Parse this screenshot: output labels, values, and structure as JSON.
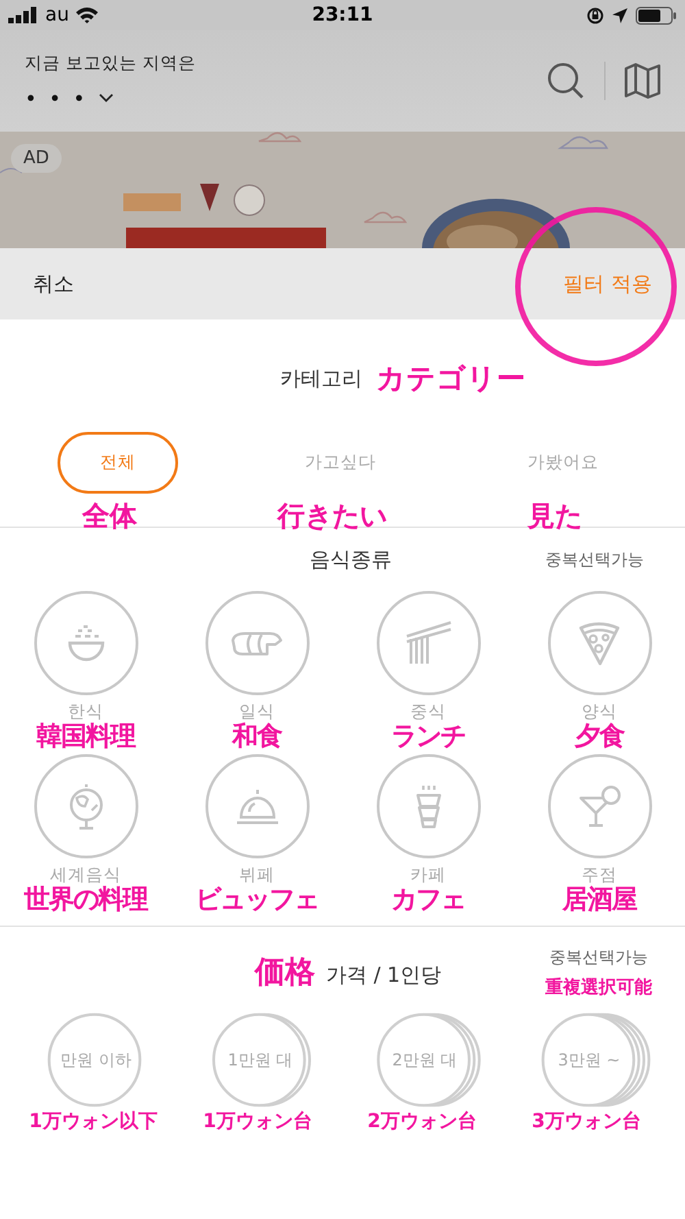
{
  "status_bar": {
    "carrier": "au",
    "time": "23:11"
  },
  "header": {
    "region_label": "지금 보고있는 지역은",
    "region_value": "• • •"
  },
  "ad": {
    "badge": "AD"
  },
  "sheet_bar": {
    "cancel": "취소",
    "apply": "필터 적용",
    "apply_circled": true
  },
  "category": {
    "title": "카테고리",
    "annotation": "カテゴリー",
    "tabs": [
      {
        "label": "전체",
        "annotation": "全体",
        "selected": true
      },
      {
        "label": "가고싶다",
        "annotation": "行きたい",
        "selected": false
      },
      {
        "label": "가봤어요",
        "annotation": "見た",
        "selected": false
      }
    ]
  },
  "food": {
    "title": "음식종류",
    "note": "중복선택가능",
    "items": [
      {
        "label": "한식",
        "annotation": "韓国料理",
        "selected": false
      },
      {
        "label": "일식",
        "annotation": "和食",
        "selected": false
      },
      {
        "label": "중식",
        "annotation": "ランチ",
        "selected": false
      },
      {
        "label": "양식",
        "annotation": "夕食",
        "selected": false
      },
      {
        "label": "세계음식",
        "annotation": "世界の料理",
        "selected": false
      },
      {
        "label": "뷔페",
        "annotation": "ビュッフェ",
        "selected": false
      },
      {
        "label": "카페",
        "annotation": "カフェ",
        "selected": false
      },
      {
        "label": "주점",
        "annotation": "居酒屋",
        "selected": false
      }
    ]
  },
  "price": {
    "title_annotation": "価格",
    "title": "가격 / 1인당",
    "note": "중복선택가능",
    "note_annotation": "重複選択可能",
    "items": [
      {
        "label": "만원 이하",
        "annotation": "1万ウォン以下",
        "selected": false
      },
      {
        "label": "1만원 대",
        "annotation": "1万ウォン台",
        "selected": false
      },
      {
        "label": "2만원 대",
        "annotation": "2万ウォン台",
        "selected": false
      },
      {
        "label": "3만원 ~",
        "annotation": "3万ウォン台",
        "selected": false
      }
    ]
  }
}
